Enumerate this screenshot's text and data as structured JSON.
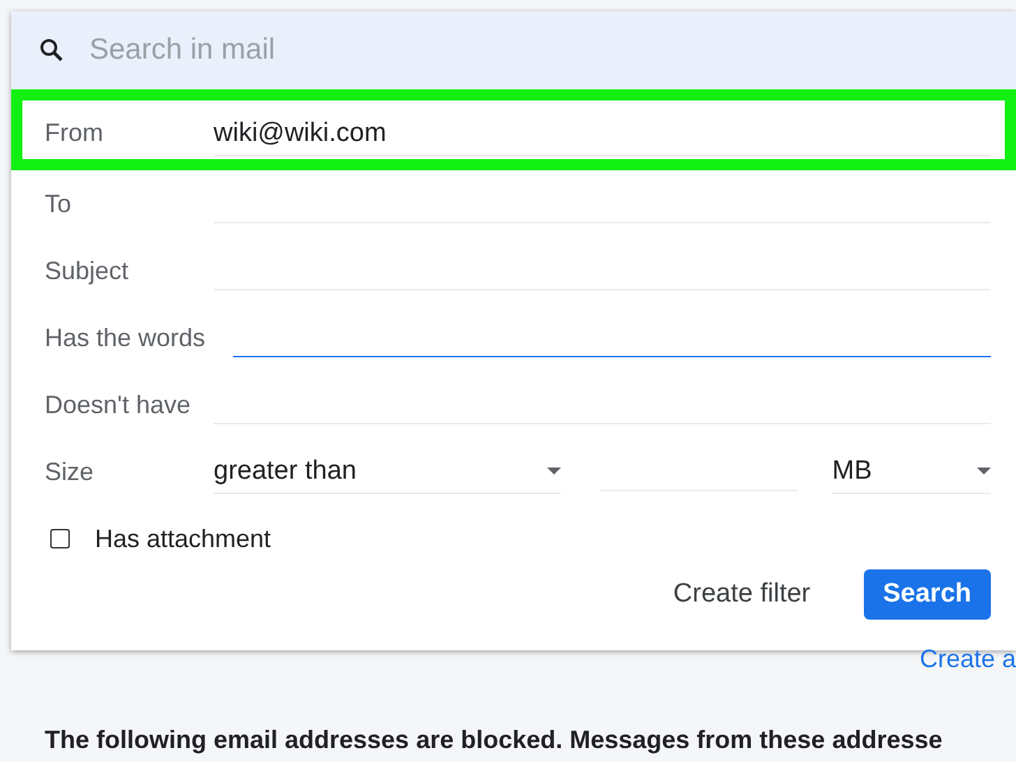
{
  "search": {
    "placeholder": "Search in mail"
  },
  "fields": [
    {
      "kind": "text",
      "label": "From",
      "value": "wiki@wiki.com",
      "highlighted": true,
      "focused": false
    },
    {
      "kind": "text",
      "label": "To",
      "highlighted": false,
      "focused": false
    },
    {
      "kind": "text",
      "label": "Subject",
      "highlighted": false,
      "focused": false
    },
    {
      "kind": "text",
      "label": "Has the words",
      "highlighted": false,
      "focused": true
    },
    {
      "kind": "text",
      "label": "Doesn't have",
      "highlighted": false,
      "focused": false
    },
    {
      "kind": "size",
      "label": "Size",
      "operator": "greater than",
      "unit": "MB"
    }
  ],
  "attachment": {
    "label": "Has attachment",
    "checked": false
  },
  "buttons": [
    {
      "kind": "text",
      "label": "Create filter"
    },
    {
      "kind": "primary",
      "label": "Search"
    }
  ],
  "link": "Create a",
  "notice": "The following email addresses are blocked. Messages from these addresse"
}
